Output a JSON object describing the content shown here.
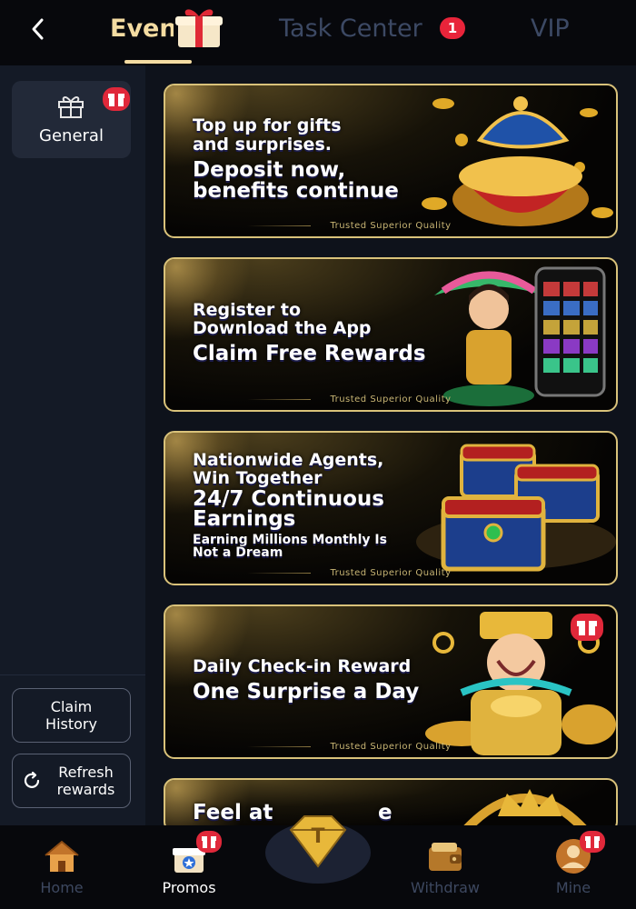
{
  "header": {
    "back_icon": "chevron-left-icon",
    "tabs": [
      {
        "label": "Events",
        "active": true
      },
      {
        "label": "Task Center",
        "badge": "1"
      },
      {
        "label": "VIP"
      }
    ],
    "accent": "#f4dca2",
    "badge_color": "#e8243a"
  },
  "sidebar": {
    "category": {
      "label": "General",
      "icon": "gift-icon"
    },
    "claim_history": "Claim\nHistory",
    "refresh": "Refresh\nrewards"
  },
  "banners": [
    {
      "lines": [
        "Top up for gifts",
        "and surprises.",
        "Deposit now,",
        "benefits continue"
      ],
      "tag": "Trusted Superior Quality"
    },
    {
      "lines": [
        "Register to",
        "Download the App",
        "Claim Free Rewards"
      ],
      "tag": "Trusted Superior Quality"
    },
    {
      "lines": [
        "Nationwide Agents,",
        "Win Together",
        "24/7 Continuous",
        "Earnings",
        "Earning Millions Monthly Is",
        "Not a Dream"
      ],
      "tag": "Trusted Superior Quality"
    },
    {
      "lines": [
        "Daily Check-in Reward",
        "One Surprise a Day"
      ],
      "tag": "Trusted Superior Quality"
    },
    {
      "lines": [
        "Feel at",
        "e"
      ]
    }
  ],
  "bottom_nav": {
    "items": [
      {
        "label": "Home",
        "icon": "house-icon"
      },
      {
        "label": "Promos",
        "icon": "gift-box-icon",
        "active": true
      },
      {
        "label": "Withdraw",
        "icon": "wallet-icon"
      },
      {
        "label": "Mine",
        "icon": "user-icon"
      }
    ],
    "center_icon": "diamond-logo-icon"
  }
}
